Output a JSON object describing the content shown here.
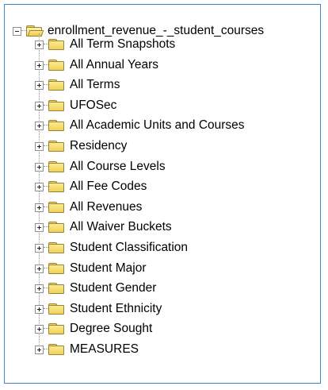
{
  "tree": {
    "root": {
      "label": "enrollment_revenue_-_student_courses",
      "expanded": true,
      "icon": "folder-open-icon"
    },
    "children": [
      {
        "label": "All Term Snapshots",
        "expanded": false,
        "icon": "folder-icon"
      },
      {
        "label": "All Annual Years",
        "expanded": false,
        "icon": "folder-icon"
      },
      {
        "label": "All Terms",
        "expanded": false,
        "icon": "folder-icon"
      },
      {
        "label": "UFOSec",
        "expanded": false,
        "icon": "folder-icon"
      },
      {
        "label": "All Academic Units and Courses",
        "expanded": false,
        "icon": "folder-icon"
      },
      {
        "label": "Residency",
        "expanded": false,
        "icon": "folder-icon"
      },
      {
        "label": "All Course Levels",
        "expanded": false,
        "icon": "folder-icon"
      },
      {
        "label": "All Fee Codes",
        "expanded": false,
        "icon": "folder-icon"
      },
      {
        "label": "All Revenues",
        "expanded": false,
        "icon": "folder-icon"
      },
      {
        "label": "All Waiver Buckets",
        "expanded": false,
        "icon": "folder-icon"
      },
      {
        "label": "Student Classification",
        "expanded": false,
        "icon": "folder-icon"
      },
      {
        "label": "Student Major",
        "expanded": false,
        "icon": "folder-icon"
      },
      {
        "label": "Student Gender",
        "expanded": false,
        "icon": "folder-icon"
      },
      {
        "label": "Student Ethnicity",
        "expanded": false,
        "icon": "folder-icon"
      },
      {
        "label": "Degree Sought",
        "expanded": false,
        "icon": "folder-icon"
      },
      {
        "label": "MEASURES",
        "expanded": false,
        "icon": "folder-icon"
      }
    ]
  },
  "colors": {
    "frame_border": "#3f86cf",
    "folder_fill": "#f3d96a",
    "folder_outline": "#9a8430",
    "connector": "#9a9a9a"
  }
}
